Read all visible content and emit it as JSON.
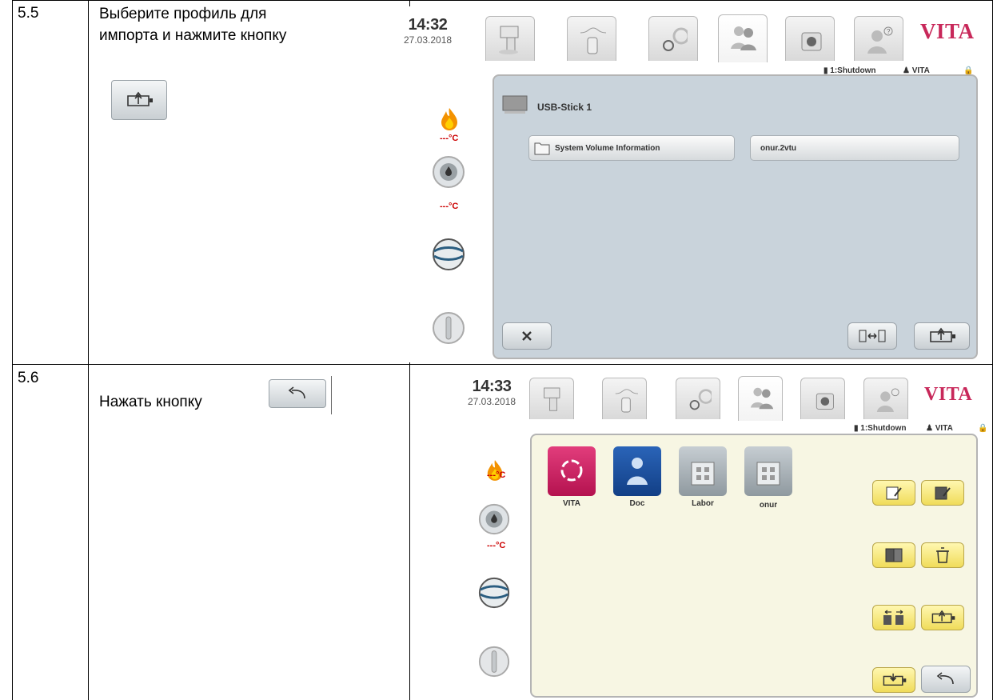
{
  "rows": [
    {
      "number": "5.5",
      "text_line1": "Выберите профиль для",
      "text_line2": "импорта и нажмите кнопку",
      "screen": {
        "time": "14:32",
        "date": "27.03.2018",
        "brand": "VITA",
        "status_program": "1:Shutdown",
        "status_user": "VITA",
        "temp1": "---°C",
        "temp2": "---°C",
        "drive_label": "USB-Stick 1",
        "folder1": "System Volume Information",
        "folder2": "onur.2vtu"
      }
    },
    {
      "number": "5.6",
      "text": "Нажать кнопку",
      "screen": {
        "time": "14:33",
        "date": "27.03.2018",
        "brand": "VITA",
        "status_program": "1:Shutdown",
        "status_user": "VITA",
        "temp1": "---°C",
        "temp2": "---°C",
        "profiles": [
          "VITA",
          "Doc",
          "Labor",
          "onur"
        ]
      }
    }
  ],
  "colors": {
    "brand": "#c8285a",
    "panel_grey": "#c9d3db",
    "panel_cream": "#f7f6e3",
    "button_yellow": "#f0dc5a"
  },
  "icons": [
    "flame-icon",
    "cycle-flame-icon",
    "vacuum-icon",
    "power-icon",
    "usb-import-icon",
    "back-arrow-icon",
    "close-icon",
    "folder-icon"
  ]
}
